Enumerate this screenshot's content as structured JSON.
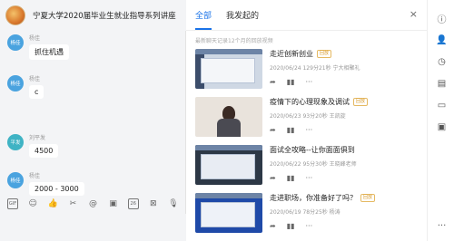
{
  "chat": {
    "title": "宁夏大学2020届毕业生就业指导系列讲座",
    "messages": [
      {
        "avatar_text": "杨佳",
        "sender": "杨佳",
        "text": "抓住机遇"
      },
      {
        "avatar_text": "杨佳",
        "sender": "杨佳",
        "text": "c"
      },
      {
        "avatar_text": "平发",
        "sender": "刘平发",
        "text": "4500"
      },
      {
        "avatar_text": "杨佳",
        "sender": "杨佳",
        "text": "2000 - 3000"
      }
    ],
    "toolbar": [
      {
        "name": "gif-icon",
        "glyph": "GIF"
      },
      {
        "name": "emoji-icon",
        "glyph": "☺"
      },
      {
        "name": "thumbs-up-icon",
        "glyph": "👍"
      },
      {
        "name": "scissors-icon",
        "glyph": "✂"
      },
      {
        "name": "at-icon",
        "glyph": "@"
      },
      {
        "name": "image-icon",
        "glyph": "▣"
      },
      {
        "name": "calendar-icon",
        "glyph": "26"
      },
      {
        "name": "hongbao-icon",
        "glyph": "⊠"
      },
      {
        "name": "mic-icon",
        "glyph": "🎙"
      }
    ]
  },
  "panel": {
    "tabs": [
      "全部",
      "我发起的"
    ],
    "active_tab": 0,
    "close_icon": "×",
    "notice": "最新聊天记录12个月的回放视频",
    "items": [
      {
        "title": "走近创新创业",
        "badge": "回放",
        "meta": "2020/06/24  129分21秒  宁大相聚礼",
        "thumb": "light"
      },
      {
        "title": "疫情下的心理现象及调试",
        "badge": "回放",
        "meta": "2020/06/23  93分20秒  王凯旋",
        "thumb": "person"
      },
      {
        "title": "面试全攻略--让你面面俱到",
        "badge": "",
        "meta": "2020/06/22  95分30秒  王晓峰老师",
        "thumb": "dark"
      },
      {
        "title": "走进职场，你准备好了吗？",
        "badge": "回放",
        "meta": "2020/06/19  78分25秒  杨涛",
        "thumb": "blue"
      }
    ],
    "action_icons": [
      "share-icon",
      "stats-icon",
      "more-icon"
    ]
  },
  "sidebar": {
    "icons": [
      "info-icon",
      "member-icon",
      "history-icon",
      "document-icon",
      "comment-icon",
      "live-icon",
      "more-icon"
    ]
  }
}
